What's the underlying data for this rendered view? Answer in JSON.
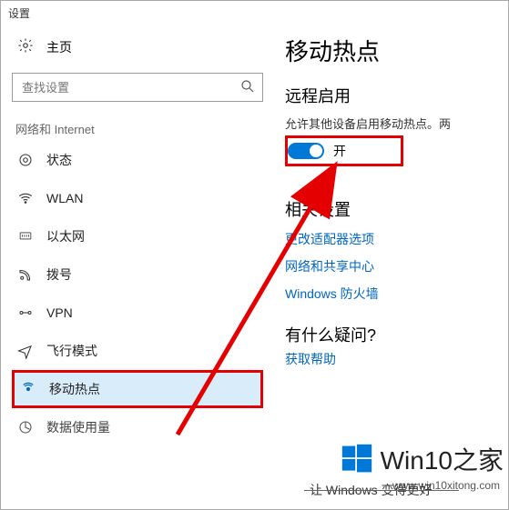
{
  "window": {
    "title": "设置"
  },
  "sidebar": {
    "home": "主页",
    "search_placeholder": "查找设置",
    "group_label": "网络和 Internet",
    "items": [
      {
        "label": "状态"
      },
      {
        "label": "WLAN"
      },
      {
        "label": "以太网"
      },
      {
        "label": "拨号"
      },
      {
        "label": "VPN"
      },
      {
        "label": "飞行模式"
      },
      {
        "label": "移动热点"
      },
      {
        "label": "数据使用量"
      }
    ]
  },
  "main": {
    "title": "移动热点",
    "remote_heading": "远程启用",
    "remote_desc": "允许其他设备启用移动热点。两",
    "toggle_label": "开",
    "related_heading": "相关设置",
    "links": [
      "更改适配器选项",
      "网络和共享中心",
      "Windows 防火墙"
    ],
    "question_heading": "有什么疑问?",
    "question_link": "获取帮助"
  },
  "watermark": {
    "text": "Win10之家",
    "sub": "www.win10xitong.com"
  },
  "footer_line": "让 Windows 变得更好"
}
